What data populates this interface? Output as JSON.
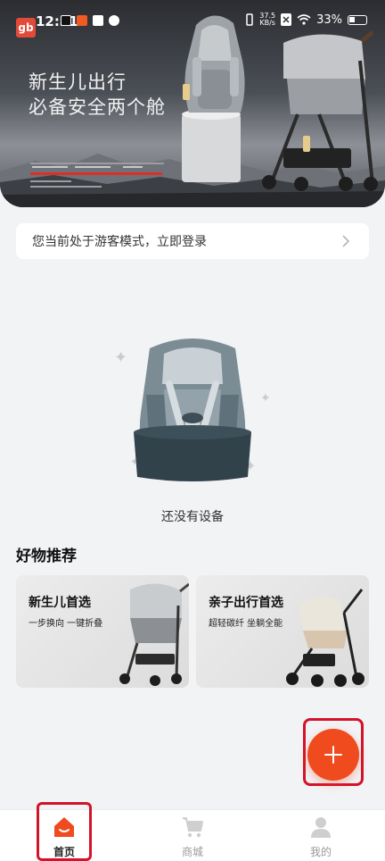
{
  "status_bar": {
    "time": "12:31",
    "network_speed_value": "37.5",
    "network_speed_unit": "KB/s",
    "battery": "33%"
  },
  "banner": {
    "headline_line1": "新生儿出行",
    "headline_line2": "必备安全两个舱"
  },
  "guest_bar": {
    "text": "您当前处于游客模式，立即登录"
  },
  "empty_state": {
    "text": "还没有设备"
  },
  "recommendations": {
    "title": "好物推荐",
    "cards": [
      {
        "title": "新生儿首选",
        "subtitle": "一步换向 一键折叠"
      },
      {
        "title": "亲子出行首选",
        "subtitle": "超轻碳纤 坐躺全能"
      }
    ]
  },
  "bottom_nav": {
    "items": [
      {
        "label": "首页",
        "icon": "home-icon",
        "active": true
      },
      {
        "label": "商城",
        "icon": "cart-icon",
        "active": false
      },
      {
        "label": "我的",
        "icon": "profile-icon",
        "active": false
      }
    ]
  },
  "colors": {
    "accent": "#f04a1f",
    "highlight_outline": "#d4122a",
    "background": "#f2f3f5"
  }
}
